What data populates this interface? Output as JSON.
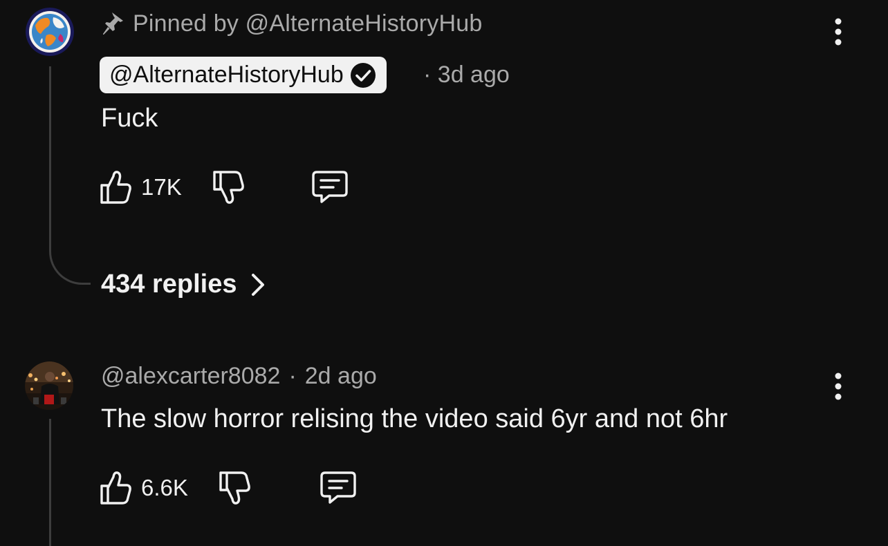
{
  "comments": [
    {
      "pinned_label": "Pinned by @AlternateHistoryHub",
      "author": "@AlternateHistoryHub",
      "time": "3d ago",
      "text": "Fuck",
      "likes": "17K",
      "replies_label": "434 replies",
      "author_verified": true,
      "icons": [
        "pin-icon",
        "verified-icon",
        "thumbs-up-icon",
        "thumbs-down-icon",
        "reply-icon",
        "chevron-right-icon",
        "more-vertical-icon"
      ]
    },
    {
      "author": "@alexcarter8082",
      "time": "2d ago",
      "text": "The slow horror relising the video said 6yr and not 6hr",
      "likes": "6.6K",
      "icons": [
        "thumbs-up-icon",
        "thumbs-down-icon",
        "reply-icon",
        "more-vertical-icon"
      ]
    }
  ],
  "colors": {
    "background": "#0f0f0f",
    "primary_text": "#f1f1f1",
    "secondary_text": "#aaaaaa",
    "thread_line": "#3d3d3d",
    "chip_background": "#f1f1f1"
  }
}
